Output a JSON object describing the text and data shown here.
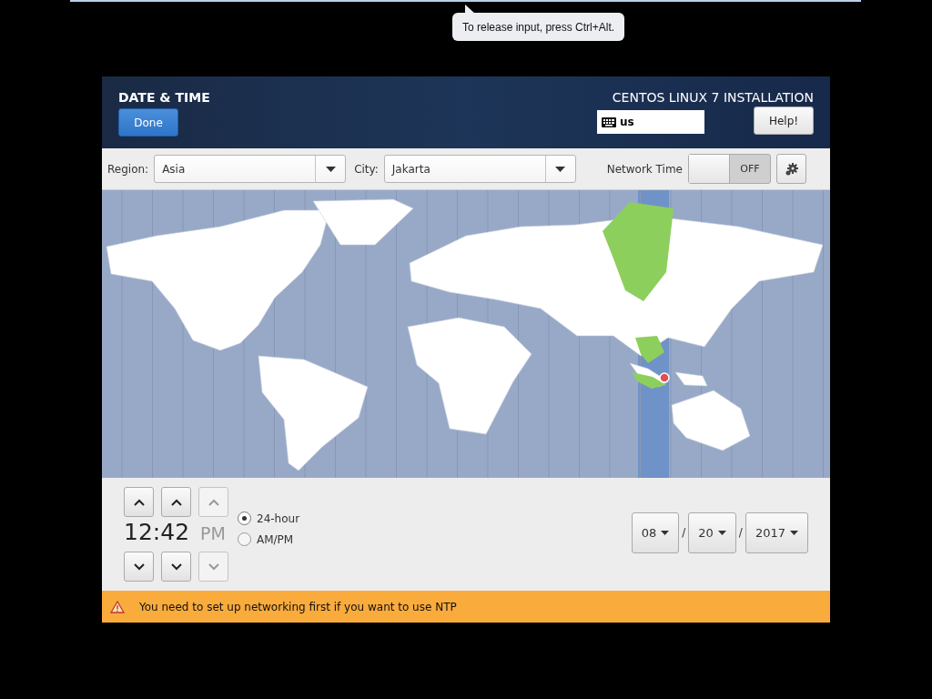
{
  "tooltip": {
    "text": "To release input, press Ctrl+Alt."
  },
  "header": {
    "title": "DATE & TIME",
    "done_button": "Done",
    "product": "CENTOS LINUX 7 INSTALLATION",
    "keyboard_layout": "us",
    "help_button": "Help!"
  },
  "toolbar": {
    "region_label": "Region:",
    "region": "Asia",
    "city_label": "City:",
    "city": "Jakarta",
    "network_time_label": "Network Time",
    "network_time": {
      "on": false,
      "label": "OFF"
    }
  },
  "time": {
    "spinners": [
      {
        "value": "12",
        "disabled": false
      },
      {
        "value": "42",
        "disabled": false
      },
      {
        "value": "PM",
        "disabled": true
      }
    ],
    "separator": ":"
  },
  "format_options": [
    {
      "label": "24-hour",
      "selected": true
    },
    {
      "label": "AM/PM",
      "selected": false
    }
  ],
  "date": {
    "fields": [
      {
        "value": "08"
      },
      {
        "value": "20"
      },
      {
        "value": "2017"
      }
    ],
    "separators": [
      "/",
      "/"
    ]
  },
  "warning": {
    "text": "You need to set up networking first if you want to use NTP"
  }
}
